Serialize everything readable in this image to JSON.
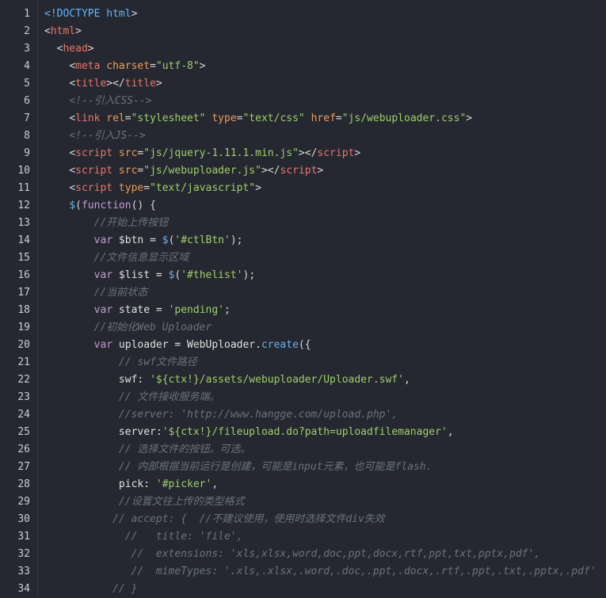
{
  "editor": {
    "lines": [
      {
        "n": "1",
        "indent": "",
        "tokens": [
          {
            "t": "<!DOCTYPE ",
            "c": "doctype"
          },
          {
            "t": "html",
            "c": "doctype"
          },
          {
            "t": ">",
            "c": "pun"
          }
        ]
      },
      {
        "n": "2",
        "indent": "",
        "tokens": [
          {
            "t": "<",
            "c": "pun"
          },
          {
            "t": "html",
            "c": "tag"
          },
          {
            "t": ">",
            "c": "pun"
          }
        ]
      },
      {
        "n": "3",
        "indent": "  ",
        "tokens": [
          {
            "t": "<",
            "c": "pun"
          },
          {
            "t": "head",
            "c": "tag"
          },
          {
            "t": ">",
            "c": "pun"
          }
        ]
      },
      {
        "n": "4",
        "indent": "    ",
        "tokens": [
          {
            "t": "<",
            "c": "pun"
          },
          {
            "t": "meta",
            "c": "tag"
          },
          {
            "t": " charset",
            "c": "attr"
          },
          {
            "t": "=",
            "c": "pun"
          },
          {
            "t": "\"utf-8\"",
            "c": "str"
          },
          {
            "t": ">",
            "c": "pun"
          }
        ]
      },
      {
        "n": "5",
        "indent": "    ",
        "tokens": [
          {
            "t": "<",
            "c": "pun"
          },
          {
            "t": "title",
            "c": "tag"
          },
          {
            "t": "></",
            "c": "pun"
          },
          {
            "t": "title",
            "c": "tag"
          },
          {
            "t": ">",
            "c": "pun"
          }
        ]
      },
      {
        "n": "6",
        "indent": "    ",
        "tokens": [
          {
            "t": "<!--引入CSS-->",
            "c": "com"
          }
        ]
      },
      {
        "n": "7",
        "indent": "    ",
        "tokens": [
          {
            "t": "<",
            "c": "pun"
          },
          {
            "t": "link",
            "c": "tag"
          },
          {
            "t": " rel",
            "c": "attr"
          },
          {
            "t": "=",
            "c": "pun"
          },
          {
            "t": "\"stylesheet\"",
            "c": "str"
          },
          {
            "t": " type",
            "c": "attr"
          },
          {
            "t": "=",
            "c": "pun"
          },
          {
            "t": "\"text/css\"",
            "c": "str"
          },
          {
            "t": " href",
            "c": "attr"
          },
          {
            "t": "=",
            "c": "pun"
          },
          {
            "t": "\"js/webuploader.css\"",
            "c": "str"
          },
          {
            "t": ">",
            "c": "pun"
          }
        ]
      },
      {
        "n": "8",
        "indent": "    ",
        "tokens": [
          {
            "t": "<!--引入JS-->",
            "c": "com"
          }
        ]
      },
      {
        "n": "9",
        "indent": "    ",
        "tokens": [
          {
            "t": "<",
            "c": "pun"
          },
          {
            "t": "script",
            "c": "tag"
          },
          {
            "t": " src",
            "c": "attr"
          },
          {
            "t": "=",
            "c": "pun"
          },
          {
            "t": "\"js/jquery-1.11.1.min.js\"",
            "c": "str"
          },
          {
            "t": "></",
            "c": "pun"
          },
          {
            "t": "script",
            "c": "tag"
          },
          {
            "t": ">",
            "c": "pun"
          }
        ]
      },
      {
        "n": "10",
        "indent": "    ",
        "tokens": [
          {
            "t": "<",
            "c": "pun"
          },
          {
            "t": "script",
            "c": "tag"
          },
          {
            "t": " src",
            "c": "attr"
          },
          {
            "t": "=",
            "c": "pun"
          },
          {
            "t": "\"js/webuploader.js\"",
            "c": "str"
          },
          {
            "t": "></",
            "c": "pun"
          },
          {
            "t": "script",
            "c": "tag"
          },
          {
            "t": ">",
            "c": "pun"
          }
        ]
      },
      {
        "n": "11",
        "indent": "    ",
        "tokens": [
          {
            "t": "<",
            "c": "pun"
          },
          {
            "t": "script",
            "c": "tag"
          },
          {
            "t": " type",
            "c": "attr"
          },
          {
            "t": "=",
            "c": "pun"
          },
          {
            "t": "\"text/javascript\"",
            "c": "str"
          },
          {
            "t": ">",
            "c": "pun"
          }
        ]
      },
      {
        "n": "12",
        "indent": "    ",
        "tokens": [
          {
            "t": "$",
            "c": "fn"
          },
          {
            "t": "(",
            "c": "pun"
          },
          {
            "t": "function",
            "c": "kw"
          },
          {
            "t": "() {",
            "c": "pun"
          }
        ]
      },
      {
        "n": "13",
        "indent": "        ",
        "tokens": [
          {
            "t": "//开始上传按钮",
            "c": "com"
          }
        ]
      },
      {
        "n": "14",
        "indent": "        ",
        "tokens": [
          {
            "t": "var",
            "c": "kw"
          },
          {
            "t": " $btn = ",
            "c": "id"
          },
          {
            "t": "$",
            "c": "fn"
          },
          {
            "t": "(",
            "c": "pun"
          },
          {
            "t": "'#ctlBtn'",
            "c": "str"
          },
          {
            "t": ");",
            "c": "pun"
          }
        ]
      },
      {
        "n": "15",
        "indent": "        ",
        "tokens": [
          {
            "t": "//文件信息显示区域",
            "c": "com"
          }
        ]
      },
      {
        "n": "16",
        "indent": "        ",
        "tokens": [
          {
            "t": "var",
            "c": "kw"
          },
          {
            "t": " $list = ",
            "c": "id"
          },
          {
            "t": "$",
            "c": "fn"
          },
          {
            "t": "(",
            "c": "pun"
          },
          {
            "t": "'#thelist'",
            "c": "str"
          },
          {
            "t": ");",
            "c": "pun"
          }
        ]
      },
      {
        "n": "17",
        "indent": "        ",
        "tokens": [
          {
            "t": "//当前状态",
            "c": "com"
          }
        ]
      },
      {
        "n": "18",
        "indent": "        ",
        "tokens": [
          {
            "t": "var",
            "c": "kw"
          },
          {
            "t": " state = ",
            "c": "id"
          },
          {
            "t": "'pending'",
            "c": "str"
          },
          {
            "t": ";",
            "c": "pun"
          }
        ]
      },
      {
        "n": "19",
        "indent": "        ",
        "tokens": [
          {
            "t": "//初始化Web Uploader",
            "c": "com"
          }
        ]
      },
      {
        "n": "20",
        "indent": "        ",
        "tokens": [
          {
            "t": "var",
            "c": "kw"
          },
          {
            "t": " uploader = WebUploader.",
            "c": "id"
          },
          {
            "t": "create",
            "c": "fn"
          },
          {
            "t": "({",
            "c": "pun"
          }
        ]
      },
      {
        "n": "21",
        "indent": "            ",
        "tokens": [
          {
            "t": "// swf文件路径",
            "c": "com"
          }
        ]
      },
      {
        "n": "22",
        "indent": "            ",
        "tokens": [
          {
            "t": "swf: ",
            "c": "id"
          },
          {
            "t": "'${ctx!}/assets/webuploader/Uploader.swf'",
            "c": "str"
          },
          {
            "t": ",",
            "c": "pun"
          }
        ]
      },
      {
        "n": "23",
        "indent": "            ",
        "tokens": [
          {
            "t": "// 文件接收服务端。",
            "c": "com"
          }
        ]
      },
      {
        "n": "24",
        "indent": "            ",
        "tokens": [
          {
            "t": "//server: 'http://www.hangge.com/upload.php',",
            "c": "com"
          }
        ]
      },
      {
        "n": "25",
        "indent": "            ",
        "tokens": [
          {
            "t": "server:",
            "c": "id"
          },
          {
            "t": "'${ctx!}/fileupload.do?path=uploadfilemanager'",
            "c": "str"
          },
          {
            "t": ",",
            "c": "pun"
          }
        ]
      },
      {
        "n": "26",
        "indent": "            ",
        "tokens": [
          {
            "t": "// 选择文件的按钮。可选。",
            "c": "com"
          }
        ]
      },
      {
        "n": "27",
        "indent": "            ",
        "tokens": [
          {
            "t": "// 内部根据当前运行是创建，可能是input元素，也可能是flash.",
            "c": "com"
          }
        ]
      },
      {
        "n": "28",
        "indent": "            ",
        "tokens": [
          {
            "t": "pick: ",
            "c": "id"
          },
          {
            "t": "'#picker'",
            "c": "str"
          },
          {
            "t": ",",
            "c": "pun"
          }
        ]
      },
      {
        "n": "29",
        "indent": "            ",
        "tokens": [
          {
            "t": "//设置文往上传的类型格式",
            "c": "com"
          }
        ]
      },
      {
        "n": "30",
        "indent": "           ",
        "tokens": [
          {
            "t": "// accept: {  //不建议使用，使用时选择文件div失效",
            "c": "com"
          }
        ]
      },
      {
        "n": "31",
        "indent": "             ",
        "tokens": [
          {
            "t": "//   title: 'file',",
            "c": "com"
          }
        ]
      },
      {
        "n": "32",
        "indent": "              ",
        "tokens": [
          {
            "t": "//  extensions: 'xls,xlsx,word,doc,ppt,docx,rtf,ppt,txt,pptx,pdf',",
            "c": "com"
          }
        ]
      },
      {
        "n": "33",
        "indent": "              ",
        "tokens": [
          {
            "t": "//  mimeTypes: '.xls,.xlsx,.word,.doc,.ppt,.docx,.rtf,.ppt,.txt,.pptx,.pdf'",
            "c": "com"
          }
        ]
      },
      {
        "n": "34",
        "indent": "           ",
        "tokens": [
          {
            "t": "// }",
            "c": "com"
          }
        ]
      }
    ]
  }
}
